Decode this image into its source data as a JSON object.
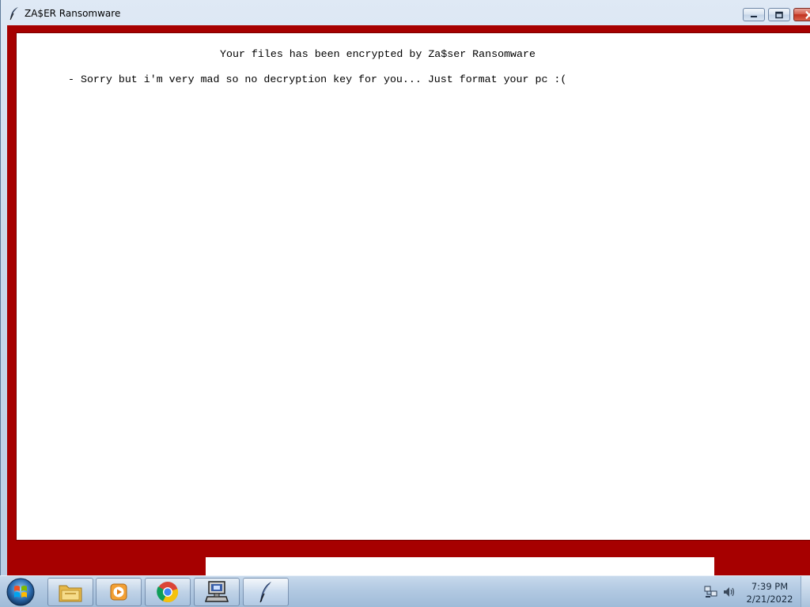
{
  "window": {
    "title": "ZA$ER Ransomware",
    "icon": "feather-icon",
    "controls": [
      "minimize-icon",
      "maximize-icon",
      "close-icon"
    ]
  },
  "message": {
    "title": "Your files has been encrypted by Za$ser Ransomware",
    "body": "- Sorry but i'm very mad so no decryption key for you... Just format your pc :("
  },
  "colors": {
    "background_red": "#a60000",
    "panel": "#ffffff"
  },
  "taskbar": {
    "start_icon": "windows-orb-icon",
    "items": [
      {
        "name": "file-explorer",
        "icon": "folder-icon"
      },
      {
        "name": "media-player",
        "icon": "media-play-icon"
      },
      {
        "name": "chrome",
        "icon": "chrome-icon"
      },
      {
        "name": "network-app",
        "icon": "computer-icon"
      },
      {
        "name": "ransomware-app",
        "icon": "feather-icon",
        "active": true
      }
    ],
    "tray": [
      "network-icon",
      "volume-icon"
    ],
    "clock": {
      "time": "7:39 PM",
      "date": "2/21/2022"
    }
  }
}
